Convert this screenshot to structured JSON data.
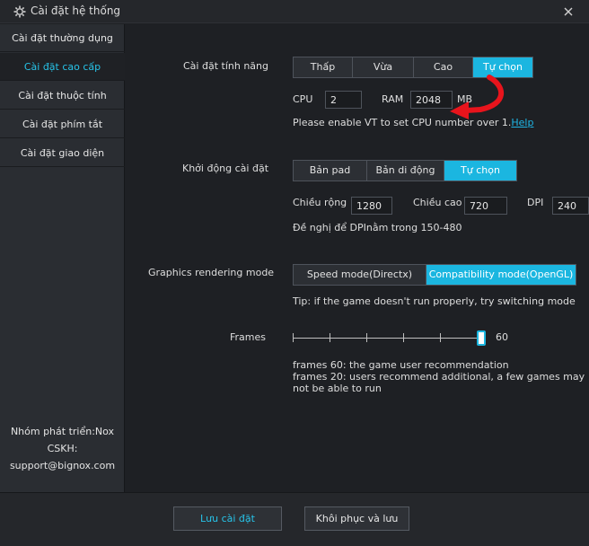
{
  "window": {
    "title": "Cài đặt hệ thống"
  },
  "sidebar": {
    "items": [
      {
        "label": "Cài đặt thường dụng"
      },
      {
        "label": "Cài đặt cao cấp"
      },
      {
        "label": "Cài đặt thuộc tính"
      },
      {
        "label": "Cài đặt phím tắt"
      },
      {
        "label": "Cài đặt giao diện"
      }
    ],
    "footer": {
      "developer": "Nhóm phát triển:Nox",
      "cskh": "CSKH:",
      "email": "support@bignox.com"
    }
  },
  "performance": {
    "label": "Cài đặt tính năng",
    "options": [
      "Thấp",
      "Vừa",
      "Cao",
      "Tự chọn"
    ],
    "selected": "Tự chọn",
    "cpu_label": "CPU",
    "cpu_value": "2",
    "ram_label": "RAM",
    "ram_value": "2048",
    "ram_unit": "MB",
    "note": "Please enable VT to set CPU number over 1.",
    "help_link": "Help"
  },
  "startup": {
    "label": "Khởi động cài đặt",
    "options": [
      "Bản pad",
      "Bản di động",
      "Tự chọn"
    ],
    "selected": "Tự chọn",
    "width_label": "Chiều rộng",
    "width_value": "1280",
    "height_label": "Chiều cao",
    "height_value": "720",
    "dpi_label": "DPI",
    "dpi_value": "240",
    "note": "Đề nghị để DPInằm trong 150-480"
  },
  "graphics": {
    "label": "Graphics rendering mode",
    "options": [
      "Speed mode(Directx)",
      "Compatibility mode(OpenGL)"
    ],
    "selected": "Compatibility mode(OpenGL)",
    "tip": "Tip: if the game doesn't run properly, try switching mode"
  },
  "frames": {
    "label": "Frames",
    "value": "60",
    "note_lines": [
      "frames 60: the game user recommendation",
      "frames 20: users recommend additional, a few games may",
      "not be able to run"
    ]
  },
  "buttons": {
    "save": "Lưu cài đặt",
    "restore": "Khôi phục và lưu"
  },
  "colors": {
    "accent": "#1bb6e0",
    "annotation_arrow": "#e8141c",
    "background": "#1e2024"
  }
}
